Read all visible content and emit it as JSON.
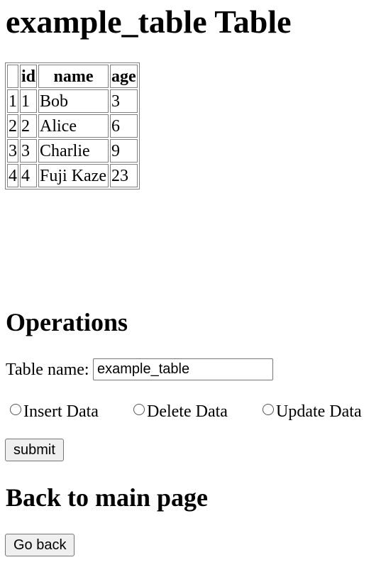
{
  "page": {
    "title": "example_table Table"
  },
  "table": {
    "headers": [
      "",
      "id",
      "name",
      "age"
    ],
    "rows": [
      [
        "1",
        "1",
        "Bob",
        "3"
      ],
      [
        "2",
        "2",
        "Alice",
        "6"
      ],
      [
        "3",
        "3",
        "Charlie",
        "9"
      ],
      [
        "4",
        "4",
        "Fuji Kaze",
        "23"
      ]
    ]
  },
  "operations": {
    "heading": "Operations",
    "table_name_label": "Table name:",
    "table_name_value": "example_table",
    "radios": [
      "Insert Data",
      "Delete Data",
      "Update Data"
    ],
    "submit_label": "submit"
  },
  "back": {
    "heading": "Back to main page",
    "button_label": "Go back"
  }
}
